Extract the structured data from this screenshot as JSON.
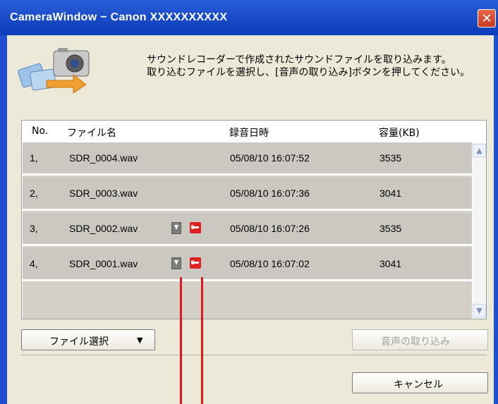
{
  "window": {
    "title": "CameraWindow − Canon XXXXXXXXXX",
    "close_symbol": "✕"
  },
  "description": {
    "line1": "サウンドレコーダーで作成されたサウンドファイルを取り込みます。",
    "line2": "取り込むファイルを選択し、[音声の取り込み]ボタンを押してください。"
  },
  "table": {
    "headers": {
      "no": "No.",
      "filename": "ファイル名",
      "datetime": "録音日時",
      "size": "容量(KB)"
    },
    "rows": [
      {
        "no": "1,",
        "filename": "SDR_0004.wav",
        "datetime": "05/08/10 16:07:52",
        "size": "3535",
        "icons": []
      },
      {
        "no": "2,",
        "filename": "SDR_0003.wav",
        "datetime": "05/08/10 16:07:36",
        "size": "3041",
        "icons": []
      },
      {
        "no": "3,",
        "filename": "SDR_0002.wav",
        "datetime": "05/08/10 16:07:26",
        "size": "3535",
        "icons": [
          "download-icon",
          "protect-key-icon"
        ]
      },
      {
        "no": "4,",
        "filename": "SDR_0001.wav",
        "datetime": "05/08/10 16:07:02",
        "size": "3041",
        "icons": [
          "download-icon",
          "protect-key-icon"
        ]
      }
    ]
  },
  "buttons": {
    "file_select": "ファイル選択",
    "file_select_arrow": "▼",
    "import": "音声の取り込み",
    "cancel": "キャンセル"
  },
  "colors": {
    "titlebar": "#1e4fcf",
    "annotation_line": "#e01818",
    "row_bg": "#cbc8c1"
  }
}
